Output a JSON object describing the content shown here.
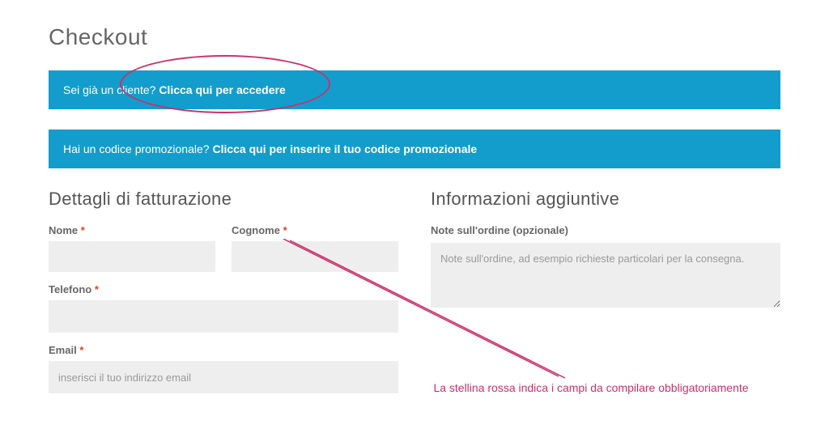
{
  "page": {
    "title": "Checkout"
  },
  "banners": {
    "login": {
      "pre": "Sei già un cliente?",
      "link": "Clicca qui per accedere"
    },
    "coupon": {
      "pre": "Hai un codice promozionale?",
      "link": "Clicca qui per inserire il tuo codice promozionale"
    }
  },
  "billing": {
    "title": "Dettagli di fatturazione",
    "fields": {
      "firstname": {
        "label": "Nome",
        "required": "*",
        "value": ""
      },
      "lastname": {
        "label": "Cognome",
        "required": "*",
        "value": ""
      },
      "phone": {
        "label": "Telefono",
        "required": "*",
        "value": ""
      },
      "email": {
        "label": "Email",
        "required": "*",
        "placeholder": "inserisci il tuo indirizzo email",
        "value": ""
      }
    }
  },
  "additional": {
    "title": "Informazioni aggiuntive",
    "notes_label": "Note sull'ordine (opzionale)",
    "notes_placeholder": "Note sull'ordine, ad esempio richieste particolari per la consegna.",
    "notes_value": ""
  },
  "annotations": {
    "star_note": "La stellina rossa indica i campi da compilare obbligatoriamente"
  }
}
